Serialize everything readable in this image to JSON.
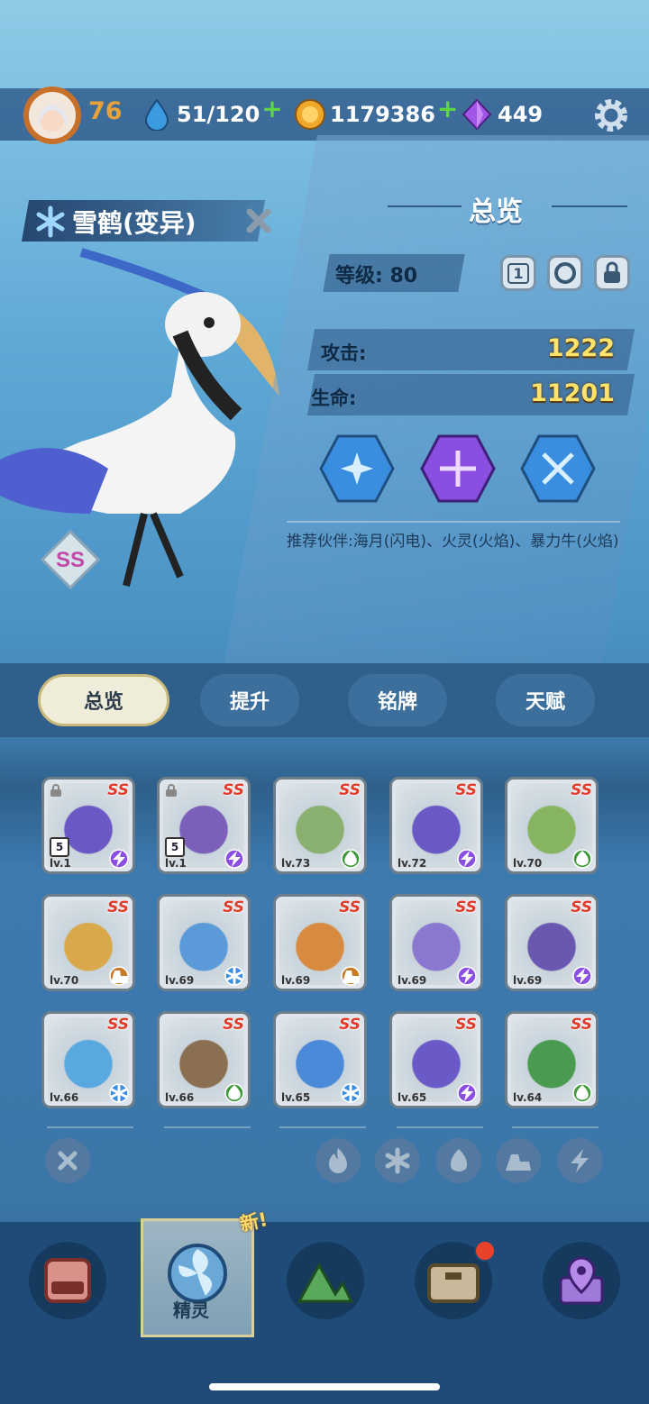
{
  "resources": {
    "player_level": "76",
    "stamina": "51/120",
    "coins": "1179386",
    "gems": "449"
  },
  "sprite": {
    "name": "雪鹤(变异)",
    "rank": "SS"
  },
  "panel": {
    "title": "总览",
    "level_label": "等级:",
    "level_value": "80",
    "star_count": "1",
    "attack_label": "攻击:",
    "attack_value": "1222",
    "hp_label": "生命:",
    "hp_value": "11201",
    "recommend_text": "推荐伙伴:海月(闪电)、火灵(火焰)、暴力牛(火焰)"
  },
  "tabs": [
    {
      "label": "总览",
      "active": true
    },
    {
      "label": "提升",
      "active": false
    },
    {
      "label": "铭牌",
      "active": false
    },
    {
      "label": "天赋",
      "active": false
    }
  ],
  "cards": [
    {
      "rank": "SS",
      "level": "lv.1",
      "element": "lightning",
      "locked": true,
      "stars": "5",
      "color": "#6a58c4"
    },
    {
      "rank": "SS",
      "level": "lv.1",
      "element": "lightning",
      "locked": true,
      "stars": "5",
      "color": "#7b5fb8"
    },
    {
      "rank": "SS",
      "level": "lv.73",
      "element": "nature",
      "locked": false,
      "stars": "",
      "color": "#8ab070"
    },
    {
      "rank": "SS",
      "level": "lv.72",
      "element": "lightning",
      "locked": false,
      "stars": "",
      "color": "#6a58c4"
    },
    {
      "rank": "SS",
      "level": "lv.70",
      "element": "nature",
      "locked": false,
      "stars": "",
      "color": "#86b460"
    },
    {
      "rank": "SS",
      "level": "lv.70",
      "element": "earth",
      "locked": false,
      "stars": "",
      "color": "#d8a84a"
    },
    {
      "rank": "SS",
      "level": "lv.69",
      "element": "ice",
      "locked": false,
      "stars": "",
      "color": "#5a9ad8"
    },
    {
      "rank": "SS",
      "level": "lv.69",
      "element": "earth",
      "locked": false,
      "stars": "",
      "color": "#d88a40"
    },
    {
      "rank": "SS",
      "level": "lv.69",
      "element": "lightning",
      "locked": false,
      "stars": "",
      "color": "#8a78d0"
    },
    {
      "rank": "SS",
      "level": "lv.69",
      "element": "lightning",
      "locked": false,
      "stars": "",
      "color": "#6a58b0"
    },
    {
      "rank": "SS",
      "level": "lv.66",
      "element": "ice",
      "locked": false,
      "stars": "",
      "color": "#5aa8e0"
    },
    {
      "rank": "SS",
      "level": "lv.66",
      "element": "nature",
      "locked": false,
      "stars": "",
      "color": "#8a7050"
    },
    {
      "rank": "SS",
      "level": "lv.65",
      "element": "ice",
      "locked": false,
      "stars": "",
      "color": "#4a8ad8"
    },
    {
      "rank": "SS",
      "level": "lv.65",
      "element": "lightning",
      "locked": false,
      "stars": "",
      "color": "#6a5ac8"
    },
    {
      "rank": "SS",
      "level": "lv.64",
      "element": "nature",
      "locked": false,
      "stars": "",
      "color": "#4a9a50"
    }
  ],
  "element_colors": {
    "lightning": "#8a4ee0",
    "nature": "#3f9a3a",
    "earth": "#c87a28",
    "ice": "#3a8ee0"
  },
  "filters": [
    "clear-icon",
    "fire-icon",
    "ice-icon",
    "nature-icon",
    "earth-icon",
    "lightning-icon"
  ],
  "bottom_nav": {
    "active_label": "精灵",
    "new_badge": "新!"
  }
}
